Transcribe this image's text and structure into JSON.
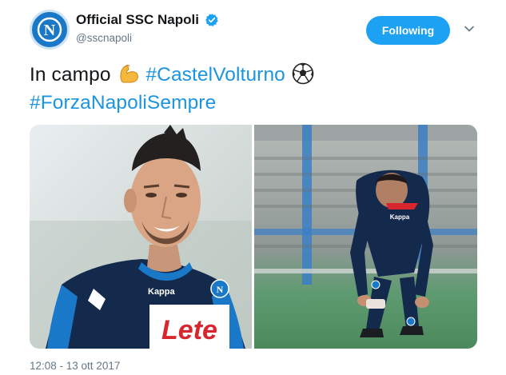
{
  "author": {
    "display_name": "Official SSC Napoli",
    "handle": "@sscnapoli",
    "avatar_letter": "N",
    "verified": true
  },
  "follow_button": {
    "label": "Following"
  },
  "tweet": {
    "text_parts": [
      "In campo",
      "#CastelVolturno",
      "#ForzaNapoliSempre"
    ],
    "emojis": [
      "flexed-biceps-emoji",
      "soccer-ball-emoji"
    ]
  },
  "media": {
    "photos": [
      {
        "jersey_sponsor": "Lete",
        "kit_brand": "Kappa"
      },
      {
        "kit_brand": "Kappa"
      }
    ]
  },
  "timestamp": "12:08 - 13 ott 2017",
  "colors": {
    "accent": "#1da1f2",
    "hashtag": "#1b95e0",
    "secondary_text": "#657786",
    "napoli_blue": "#1a78c8",
    "kit_navy": "#132a4d",
    "sponsor_red": "#d8262f"
  }
}
